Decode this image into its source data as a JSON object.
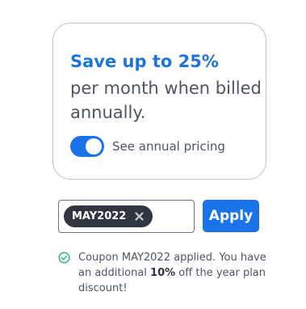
{
  "promo": {
    "headline": "Save up to 25%",
    "body": "per month when billed annually.",
    "toggle": {
      "state": "on",
      "label": "See annual pricing"
    }
  },
  "coupon": {
    "chip_code": "MAY2022",
    "apply_label": "Apply",
    "message": {
      "prefix": "Coupon MAY2022 applied. You have an additional ",
      "highlight": "10%",
      "suffix": " off the year plan discount!"
    }
  },
  "colors": {
    "accent": "#1a73e8",
    "headline": "#1f74da",
    "chip_bg": "#2f3640",
    "success": "#2eb87a"
  }
}
